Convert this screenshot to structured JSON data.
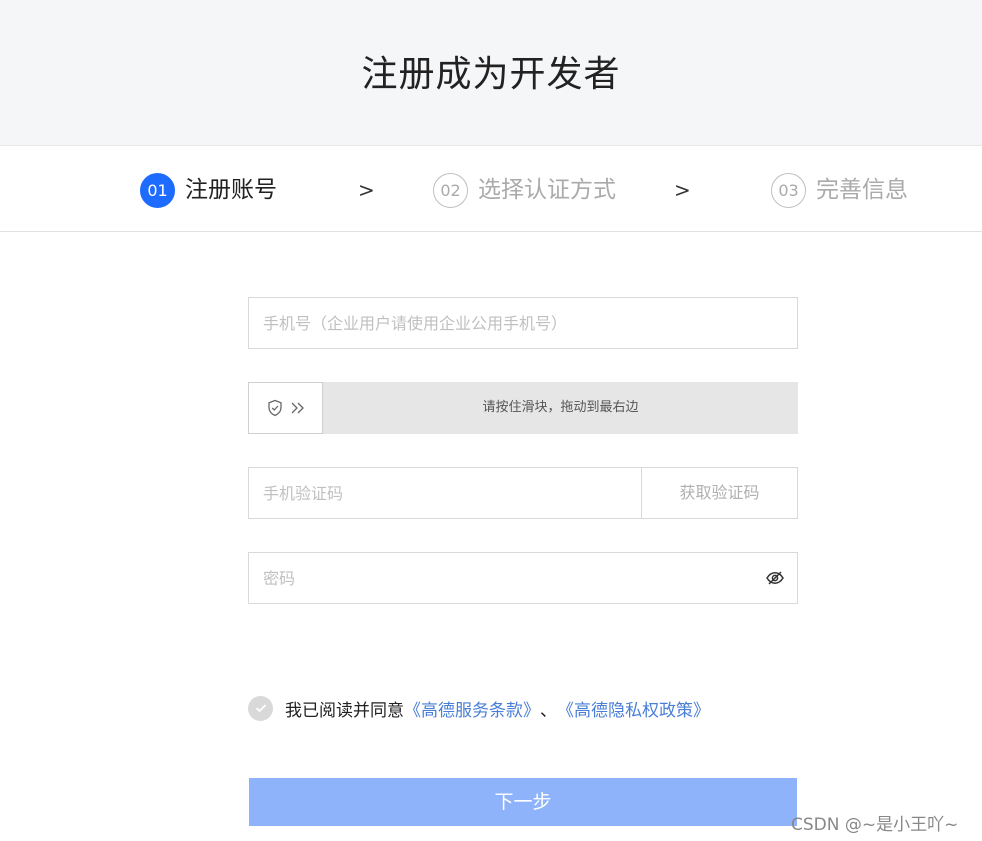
{
  "header": {
    "title": "注册成为开发者"
  },
  "steps": [
    {
      "num": "01",
      "label": "注册账号"
    },
    {
      "num": "02",
      "label": "选择认证方式"
    },
    {
      "num": "03",
      "label": "完善信息"
    }
  ],
  "step_separator": ">",
  "form": {
    "phone_placeholder": "手机号（企业用户请使用企业公用手机号）",
    "slider_text": "请按住滑块，拖动到最右边",
    "sms_placeholder": "手机验证码",
    "get_code_label": "获取验证码",
    "password_placeholder": "密码"
  },
  "agreement": {
    "text": "我已阅读并同意",
    "link1": "《高德服务条款》",
    "separator": "、",
    "link2": "《高德隐私权政策》"
  },
  "next_button": "下一步",
  "watermark": "CSDN @~是小王吖~",
  "colors": {
    "primary": "#1e6bff",
    "button_disabled": "#8fb3fb",
    "link": "#4a7fd6"
  },
  "icons": [
    "shield-check-icon",
    "double-chevron-right-icon",
    "eye-off-icon",
    "check-icon"
  ]
}
